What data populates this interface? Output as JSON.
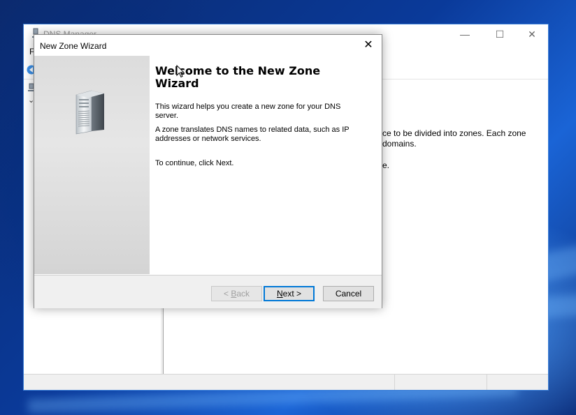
{
  "dns_manager": {
    "title": "DNS Manager",
    "menu_first_letter": "F",
    "content_lines": [
      "ce to be divided into zones. Each zone",
      "domains.",
      "e."
    ]
  },
  "window_controls": {
    "minimize": "—",
    "maximize": "☐",
    "close": "✕"
  },
  "wizard": {
    "title": "New Zone Wizard",
    "close_glyph": "✕",
    "heading": "Welcome to the New Zone Wizard",
    "paragraphs": [
      "This wizard helps you create a new zone for your DNS server.",
      "A zone translates DNS names to related data, such as IP addresses or network services.",
      "To continue, click Next."
    ],
    "buttons": {
      "back_mnemonic": "B",
      "back_rest": "ack",
      "back_prefix": "< ",
      "next_mnemonic": "N",
      "next_rest": "ext >",
      "cancel": "Cancel"
    }
  },
  "colors": {
    "accent": "#0078d7",
    "window_border": "#3c7fd6",
    "wizard_side_panel": "#dcdcdc",
    "footer": "#f0f0f0"
  },
  "icons": [
    "server-tower-icon",
    "dns-manager-icon",
    "back-arrow-icon",
    "tree-node-icon",
    "chevron-down-icon",
    "mouse-cursor-icon"
  ]
}
